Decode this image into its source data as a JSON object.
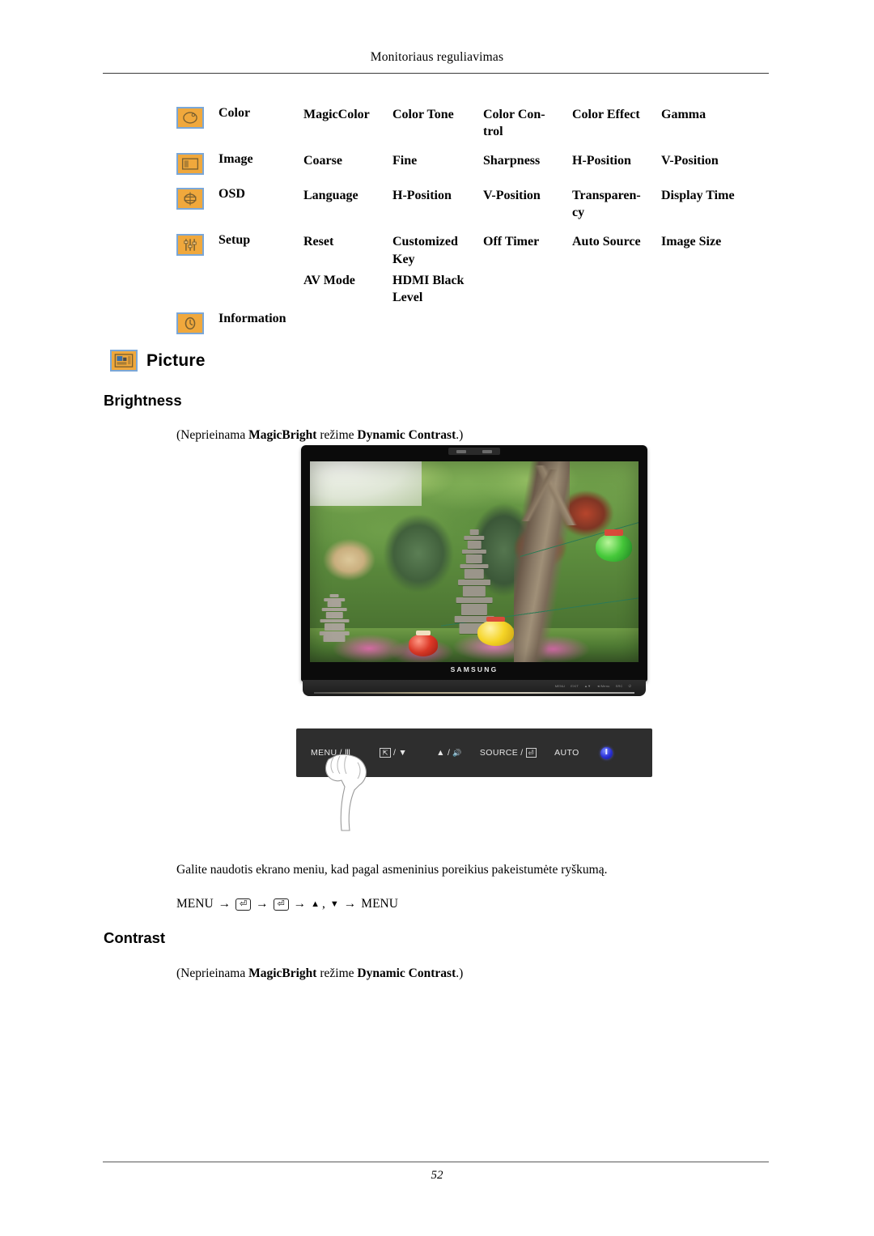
{
  "header": {
    "title": "Monitoriaus reguliavimas"
  },
  "menu_map": {
    "rows": [
      {
        "icon": "color-palette-icon",
        "label": "Color",
        "cols": [
          "MagicColor",
          "Color Tone",
          "Color Con-trol",
          "Color Effect",
          "Gamma"
        ],
        "col1": "MagicColor",
        "col2": "Color Tone",
        "col3": "Color Con-",
        "col3b": "trol",
        "col4": "Color Effect",
        "col5": "Gamma"
      },
      {
        "icon": "image-frame-icon",
        "label": "Image",
        "col1": "Coarse",
        "col2": "Fine",
        "col3": "Sharpness",
        "col3b": "",
        "col4": "H-Position",
        "col5": "V-Position"
      },
      {
        "icon": "osd-icon",
        "label": "OSD",
        "col1": "Language",
        "col2": "H-Position",
        "col3": "V-Position",
        "col3b": "",
        "col4": "Transparen-",
        "col4b": "cy",
        "col5": "Display Time"
      },
      {
        "icon": "setup-sliders-icon",
        "label": "Setup",
        "col1": "Reset",
        "col2": "Customized",
        "col2b": "Key",
        "col3": "Off Timer",
        "col4": "Auto Source",
        "col5": "Image Size"
      },
      {
        "icon": "",
        "label": "",
        "col1": "AV Mode",
        "col2": "HDMI Black",
        "col2b": "Level",
        "col3": "",
        "col4": "",
        "col5": ""
      },
      {
        "icon": "information-clock-icon",
        "label": "Information",
        "col1": "",
        "col2": "",
        "col3": "",
        "col4": "",
        "col5": ""
      }
    ]
  },
  "sections": {
    "picture": {
      "icon": "picture-icon",
      "title": "Picture"
    },
    "brightness": {
      "title": "Brightness",
      "note_open": "(Neprieinama ",
      "note_bold1": "MagicBright",
      "note_mid": " režime ",
      "note_bold2": "Dynamic Contrast",
      "note_close": ".)",
      "usage": "Galite naudotis ekrano meniu, kad pagal asmeninius poreikius pakeistumėte ryškumą.",
      "nav": {
        "start": "MENU",
        "arrow": "→",
        "enter_key": "⏎",
        "up_arrow": "▲",
        "comma": ",",
        "down_arrow": "▼",
        "end": "MENU"
      }
    },
    "contrast": {
      "title": "Contrast",
      "note_open": "(Neprieinama ",
      "note_bold1": "MagicBright",
      "note_mid": " režime ",
      "note_bold2": "Dynamic Contrast",
      "note_close": ".)"
    }
  },
  "monitor": {
    "brand": "SAMSUNG",
    "stand_keys": [
      "MENU",
      "EXIT",
      "▲▼",
      "◄/Menu",
      "SRC",
      "⏻"
    ],
    "control_panel": {
      "menu_label": "MENU",
      "menu_glyph": "Ⅲ",
      "down_glyph": "⇱",
      "down_arrow": "▼",
      "up_arrow": "▲",
      "speaker_glyph": "🔊",
      "source_label": "SOURCE",
      "enter_glyph": "⏎",
      "auto_label": "AUTO",
      "power_glyph": "⏻",
      "separator": "/"
    }
  },
  "footer": {
    "page_number": "52"
  },
  "colors": {
    "icon_fill": "#f0a83c",
    "icon_border": "#7ba7d7",
    "panel_bg": "#2e2e2e",
    "power_blue": "#2a2fd6"
  }
}
